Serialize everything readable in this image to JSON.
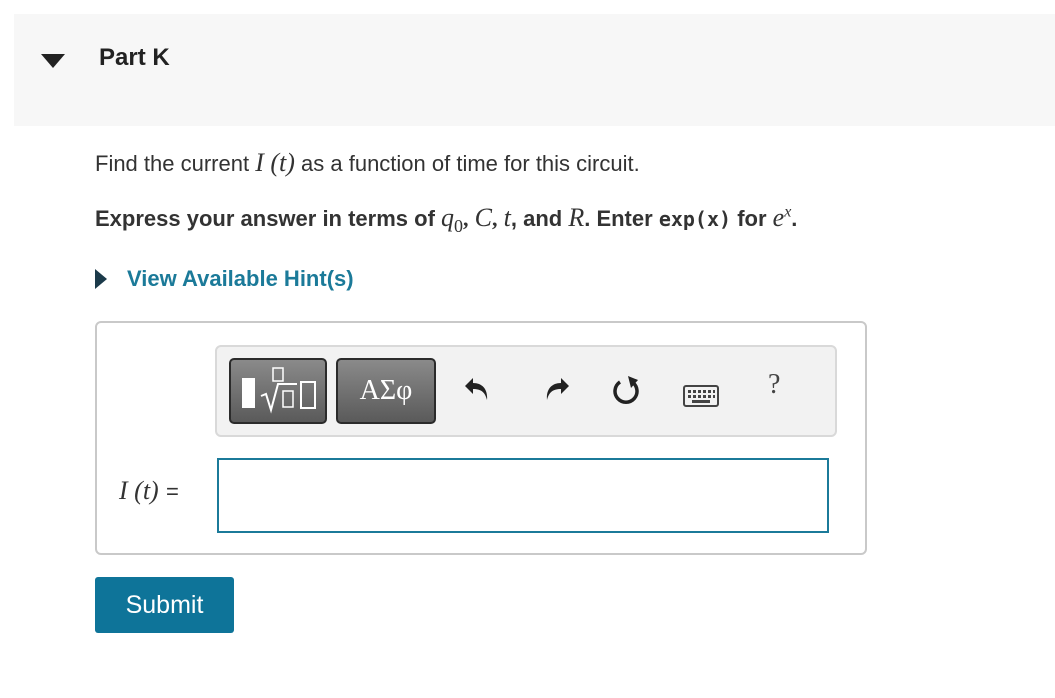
{
  "part": {
    "title": "Part K"
  },
  "question": {
    "prefix": "Find the current",
    "func": "I (t)",
    "suffix": "as a function of time for this circuit."
  },
  "instructions": {
    "prefix": "Express your answer in terms of",
    "v1": "q",
    "v1_sub": "0",
    "sep1": ",",
    "v2": "C",
    "sep2": ",",
    "v3": "t",
    "sep3": ", and",
    "v4": "R",
    "mid": ". Enter",
    "code": "exp(x)",
    "for": "for",
    "exp_base": "e",
    "exp_power": "x",
    "end": "."
  },
  "hint": {
    "label": "View Available Hint(s)"
  },
  "toolbar": {
    "templates_icon": "templates-icon",
    "symbols_label": "ΑΣφ",
    "undo_icon": "undo-icon",
    "redo_icon": "redo-icon",
    "reset_icon": "reset-icon",
    "keyboard_icon": "keyboard-icon",
    "help_label": "?"
  },
  "answer": {
    "label": "I (t)",
    "equals": "=",
    "value": ""
  },
  "submit": {
    "label": "Submit"
  },
  "colors": {
    "accent": "#1b7a99",
    "submit_bg": "#0e7499",
    "header_bg": "#f7f7f7"
  }
}
